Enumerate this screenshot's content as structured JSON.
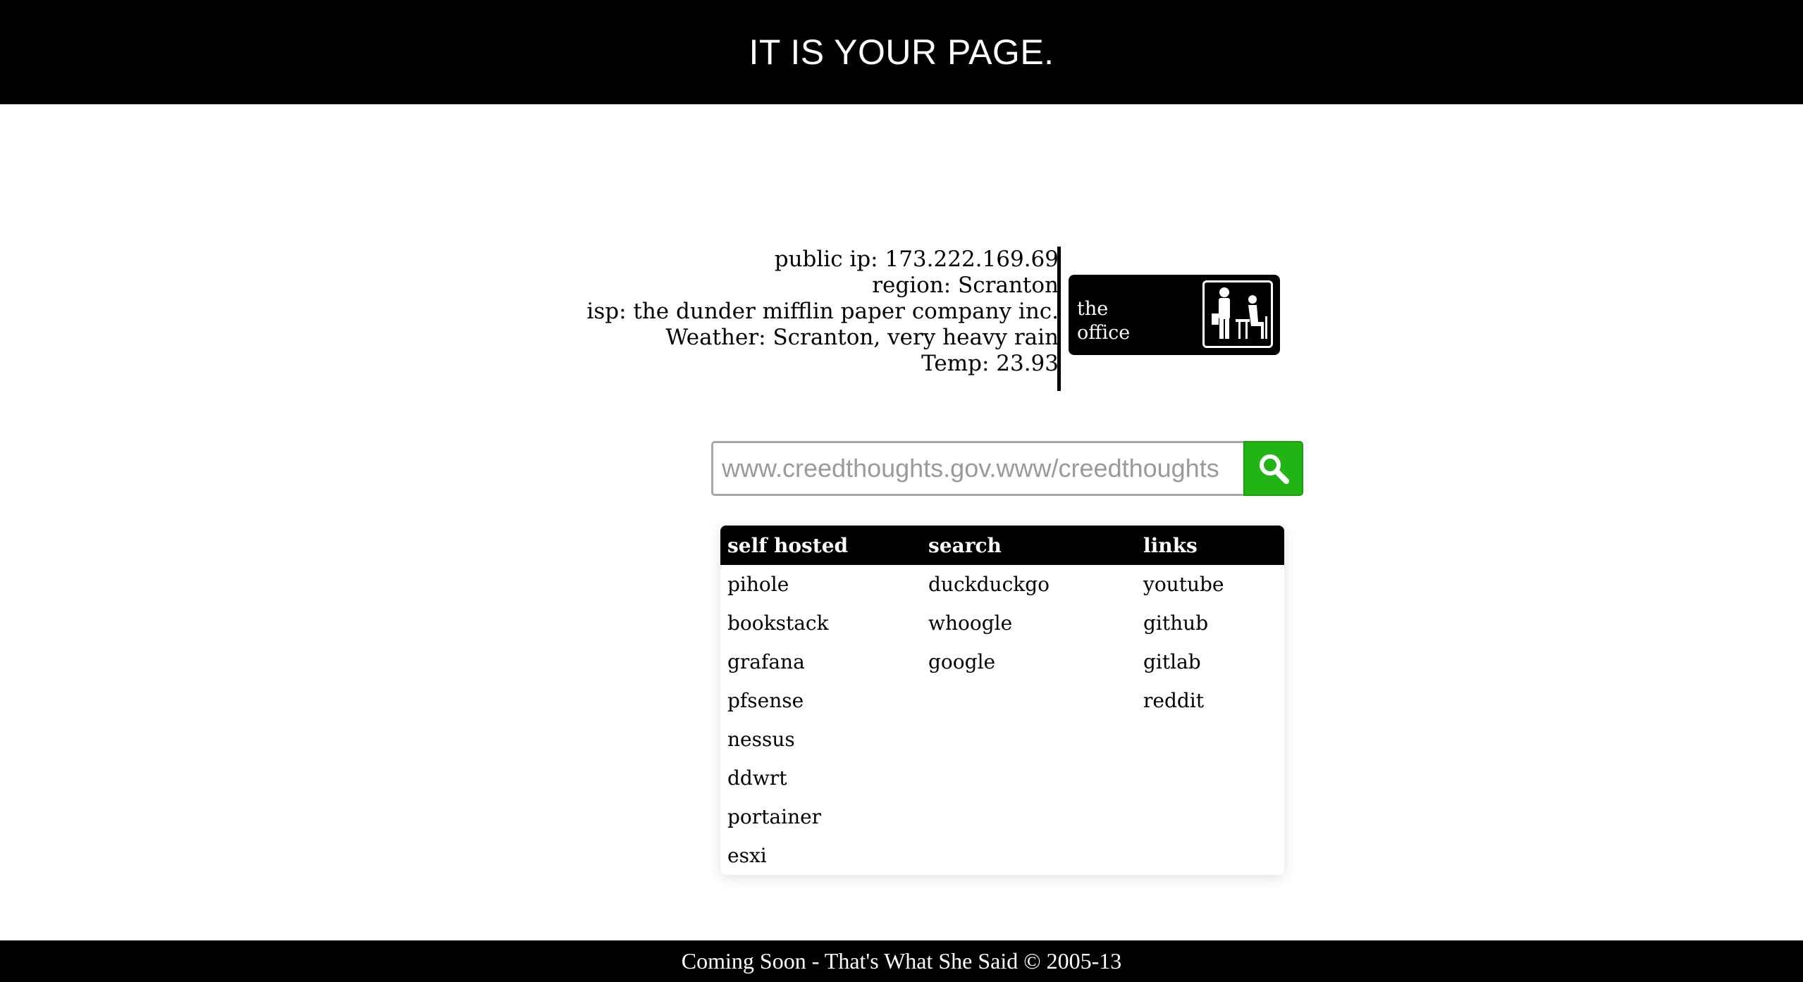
{
  "header": {
    "title": "IT IS YOUR PAGE."
  },
  "info": {
    "public_ip": "public ip: 173.222.169.69",
    "region": "region: Scranton",
    "isp": "isp: the dunder mifflin paper company inc.",
    "weather": "Weather: Scranton, very heavy rain",
    "temp": "Temp: 23.93"
  },
  "logo": {
    "line1": "the",
    "line2": "office"
  },
  "search": {
    "placeholder": "www.creedthoughts.gov.www/creedthoughts",
    "value": "",
    "button_icon": "magnifier-icon",
    "button_color": "#22b314"
  },
  "links_table": {
    "headers": [
      "self hosted",
      "search",
      "links"
    ],
    "rows": [
      [
        "pihole",
        "duckduckgo",
        "youtube"
      ],
      [
        "bookstack",
        "whoogle",
        "github"
      ],
      [
        "grafana",
        "google",
        "gitlab"
      ],
      [
        "pfsense",
        "",
        "reddit"
      ],
      [
        "nessus",
        "",
        ""
      ],
      [
        "ddwrt",
        "",
        ""
      ],
      [
        "portainer",
        "",
        ""
      ],
      [
        "esxi",
        "",
        ""
      ]
    ]
  },
  "footer": {
    "text": "Coming Soon - That's What She Said © 2005-13"
  }
}
